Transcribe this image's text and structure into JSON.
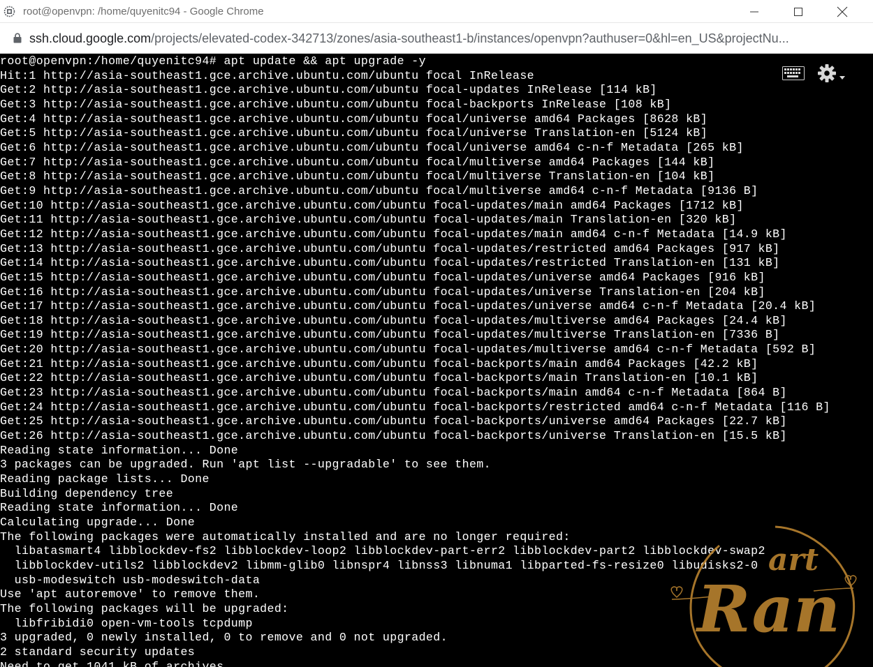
{
  "window": {
    "title": "root@openvpn: /home/quyenitc94 - Google Chrome"
  },
  "address_bar": {
    "url_host": "ssh.cloud.google.com",
    "url_path": "/projects/elevated-codex-342713/zones/asia-southeast1-b/instances/openvpn?authuser=0&hl=en_US&projectNu..."
  },
  "terminal": {
    "lines": [
      "root@openvpn:/home/quyenitc94# apt update && apt upgrade -y",
      "Hit:1 http://asia-southeast1.gce.archive.ubuntu.com/ubuntu focal InRelease",
      "Get:2 http://asia-southeast1.gce.archive.ubuntu.com/ubuntu focal-updates InRelease [114 kB]",
      "Get:3 http://asia-southeast1.gce.archive.ubuntu.com/ubuntu focal-backports InRelease [108 kB]",
      "Get:4 http://asia-southeast1.gce.archive.ubuntu.com/ubuntu focal/universe amd64 Packages [8628 kB]",
      "Get:5 http://asia-southeast1.gce.archive.ubuntu.com/ubuntu focal/universe Translation-en [5124 kB]",
      "Get:6 http://asia-southeast1.gce.archive.ubuntu.com/ubuntu focal/universe amd64 c-n-f Metadata [265 kB]",
      "Get:7 http://asia-southeast1.gce.archive.ubuntu.com/ubuntu focal/multiverse amd64 Packages [144 kB]",
      "Get:8 http://asia-southeast1.gce.archive.ubuntu.com/ubuntu focal/multiverse Translation-en [104 kB]",
      "Get:9 http://asia-southeast1.gce.archive.ubuntu.com/ubuntu focal/multiverse amd64 c-n-f Metadata [9136 B]",
      "Get:10 http://asia-southeast1.gce.archive.ubuntu.com/ubuntu focal-updates/main amd64 Packages [1712 kB]",
      "Get:11 http://asia-southeast1.gce.archive.ubuntu.com/ubuntu focal-updates/main Translation-en [320 kB]",
      "Get:12 http://asia-southeast1.gce.archive.ubuntu.com/ubuntu focal-updates/main amd64 c-n-f Metadata [14.9 kB]",
      "Get:13 http://asia-southeast1.gce.archive.ubuntu.com/ubuntu focal-updates/restricted amd64 Packages [917 kB]",
      "Get:14 http://asia-southeast1.gce.archive.ubuntu.com/ubuntu focal-updates/restricted Translation-en [131 kB]",
      "Get:15 http://asia-southeast1.gce.archive.ubuntu.com/ubuntu focal-updates/universe amd64 Packages [916 kB]",
      "Get:16 http://asia-southeast1.gce.archive.ubuntu.com/ubuntu focal-updates/universe Translation-en [204 kB]",
      "Get:17 http://asia-southeast1.gce.archive.ubuntu.com/ubuntu focal-updates/universe amd64 c-n-f Metadata [20.4 kB]",
      "Get:18 http://asia-southeast1.gce.archive.ubuntu.com/ubuntu focal-updates/multiverse amd64 Packages [24.4 kB]",
      "Get:19 http://asia-southeast1.gce.archive.ubuntu.com/ubuntu focal-updates/multiverse Translation-en [7336 B]",
      "Get:20 http://asia-southeast1.gce.archive.ubuntu.com/ubuntu focal-updates/multiverse amd64 c-n-f Metadata [592 B]",
      "Get:21 http://asia-southeast1.gce.archive.ubuntu.com/ubuntu focal-backports/main amd64 Packages [42.2 kB]",
      "Get:22 http://asia-southeast1.gce.archive.ubuntu.com/ubuntu focal-backports/main Translation-en [10.1 kB]",
      "Get:23 http://asia-southeast1.gce.archive.ubuntu.com/ubuntu focal-backports/main amd64 c-n-f Metadata [864 B]",
      "Get:24 http://asia-southeast1.gce.archive.ubuntu.com/ubuntu focal-backports/restricted amd64 c-n-f Metadata [116 B]",
      "Get:25 http://asia-southeast1.gce.archive.ubuntu.com/ubuntu focal-backports/universe amd64 Packages [22.7 kB]",
      "Get:26 http://asia-southeast1.gce.archive.ubuntu.com/ubuntu focal-backports/universe Translation-en [15.5 kB]",
      "Reading state information... Done",
      "3 packages can be upgraded. Run 'apt list --upgradable' to see them.",
      "Reading package lists... Done",
      "Building dependency tree",
      "Reading state information... Done",
      "Calculating upgrade... Done",
      "The following packages were automatically installed and are no longer required:",
      "  libatasmart4 libblockdev-fs2 libblockdev-loop2 libblockdev-part-err2 libblockdev-part2 libblockdev-swap2",
      "  libblockdev-utils2 libblockdev2 libmm-glib0 libnspr4 libnss3 libnuma1 libparted-fs-resize0 libudisks2-0",
      "  usb-modeswitch usb-modeswitch-data",
      "Use 'apt autoremove' to remove them.",
      "The following packages will be upgraded:",
      "  libfribidi0 open-vm-tools tcpdump",
      "3 upgraded, 0 newly installed, 0 to remove and 0 not upgraded.",
      "2 standard security updates",
      "Need to get 1041 kB of archives."
    ],
    "icons": [
      "keyboard-icon",
      "gear-icon"
    ]
  },
  "watermark": {
    "text_top": "art",
    "text_main": "Ran",
    "color": "#b9822f"
  },
  "colors": {
    "terminal_bg": "#000000",
    "terminal_fg": "#ffffff",
    "titlebar_bg": "#ffffff",
    "title_text": "#6e6e6e"
  }
}
